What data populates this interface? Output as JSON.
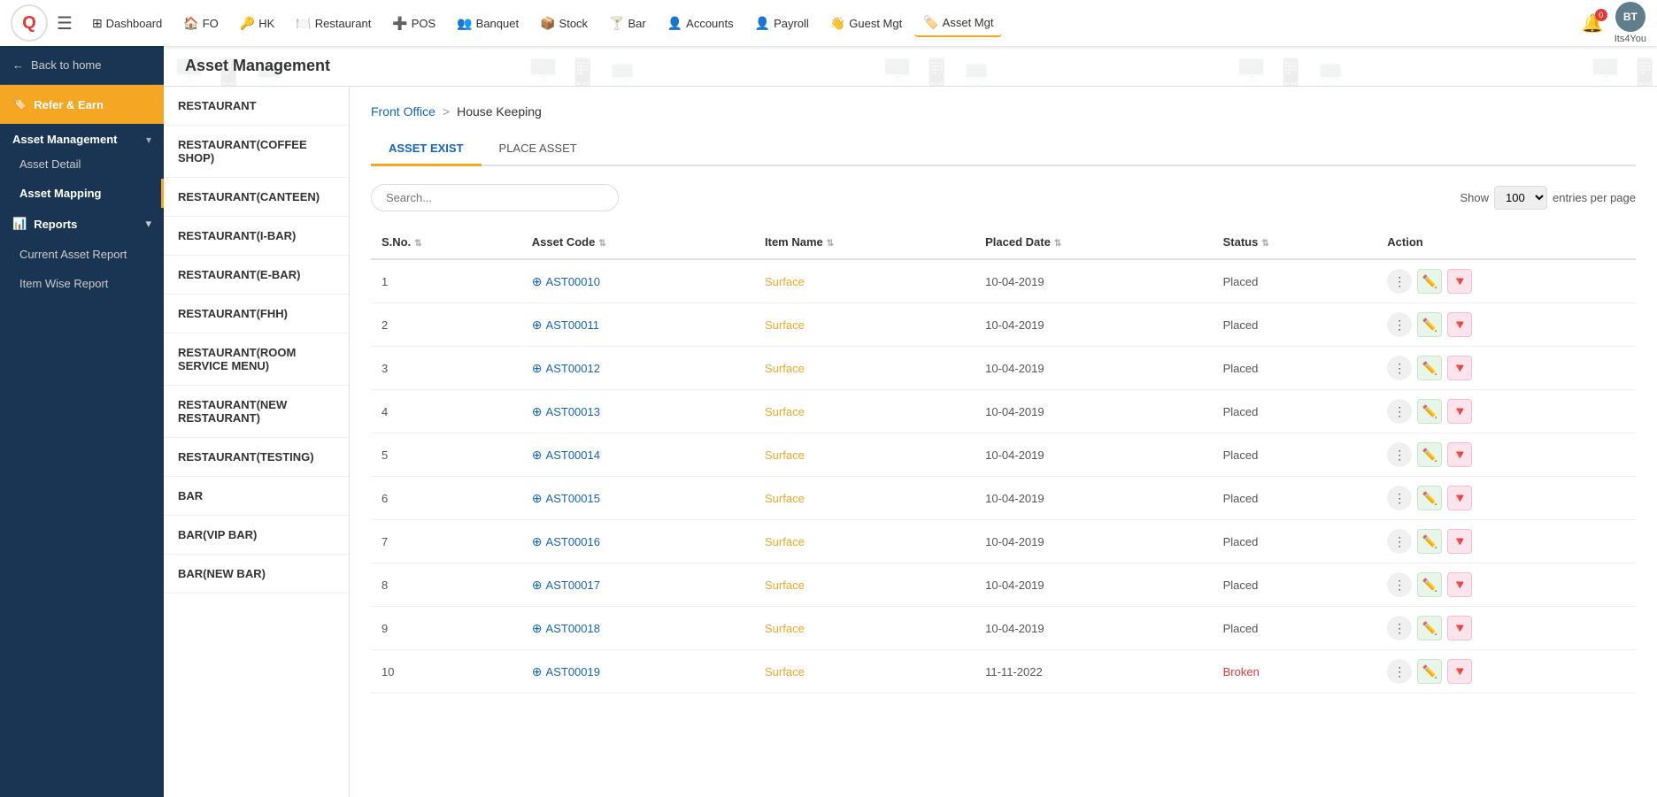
{
  "nav": {
    "hamburger": "☰",
    "logo_text": "Q",
    "items": [
      {
        "label": "Dashboard",
        "icon": "⊞",
        "active": false
      },
      {
        "label": "FO",
        "icon": "🏠",
        "active": false
      },
      {
        "label": "HK",
        "icon": "🔑",
        "active": false
      },
      {
        "label": "Restaurant",
        "icon": "🍽️",
        "active": false
      },
      {
        "label": "POS",
        "icon": "➕",
        "active": false
      },
      {
        "label": "Banquet",
        "icon": "👥",
        "active": false
      },
      {
        "label": "Stock",
        "icon": "📦",
        "active": false
      },
      {
        "label": "Bar",
        "icon": "🍸",
        "active": false
      },
      {
        "label": "Accounts",
        "icon": "👤",
        "active": false
      },
      {
        "label": "Payroll",
        "icon": "👤",
        "active": false
      },
      {
        "label": "Guest Mgt",
        "icon": "👋",
        "active": false
      },
      {
        "label": "Asset Mgt",
        "icon": "🏷️",
        "active": true
      }
    ],
    "bell_count": "0",
    "user_initials": "BT",
    "user_name": "Its4You"
  },
  "sidebar": {
    "back_label": "Back to home",
    "refer_label": "Refer & Earn",
    "asset_management_label": "Asset Management",
    "asset_detail_label": "Asset Detail",
    "asset_mapping_label": "Asset Mapping",
    "reports_label": "Reports",
    "current_asset_report_label": "Current Asset Report",
    "item_wise_report_label": "Item Wise Report"
  },
  "page_header": "Asset Management",
  "left_panel": {
    "items": [
      {
        "label": "RESTAURANT",
        "active": false
      },
      {
        "label": "RESTAURANT(COFFEE SHOP)",
        "active": false
      },
      {
        "label": "RESTAURANT(CANTEEN)",
        "active": false
      },
      {
        "label": "RESTAURANT(I-BAR)",
        "active": false
      },
      {
        "label": "RESTAURANT(E-BAR)",
        "active": false
      },
      {
        "label": "RESTAURANT(FHH)",
        "active": false
      },
      {
        "label": "RESTAURANT(ROOM SERVICE MENU)",
        "active": false
      },
      {
        "label": "RESTAURANT(NEW RESTAURANT)",
        "active": false
      },
      {
        "label": "RESTAURANT(TESTING)",
        "active": false
      },
      {
        "label": "BAR",
        "active": false
      },
      {
        "label": "BAR(VIP BAR)",
        "active": false
      },
      {
        "label": "BAR(NEW BAR)",
        "active": false
      }
    ]
  },
  "breadcrumb": {
    "home": "Front Office",
    "sep": ">",
    "current": "House Keeping"
  },
  "tabs": [
    {
      "label": "ASSET EXIST",
      "active": true
    },
    {
      "label": "PLACE ASSET",
      "active": false
    }
  ],
  "table_controls": {
    "search_placeholder": "Search...",
    "show_label": "Show",
    "entries_value": "100",
    "entries_label": "entries per page"
  },
  "table": {
    "columns": [
      "S.No.",
      "Asset Code",
      "Item Name",
      "Placed Date",
      "Status",
      "Action"
    ],
    "rows": [
      {
        "sno": "1",
        "asset_code": "AST00010",
        "item_name": "Surface",
        "placed_date": "10-04-2019",
        "status": "Placed",
        "status_type": "placed"
      },
      {
        "sno": "2",
        "asset_code": "AST00011",
        "item_name": "Surface",
        "placed_date": "10-04-2019",
        "status": "Placed",
        "status_type": "placed"
      },
      {
        "sno": "3",
        "asset_code": "AST00012",
        "item_name": "Surface",
        "placed_date": "10-04-2019",
        "status": "Placed",
        "status_type": "placed"
      },
      {
        "sno": "4",
        "asset_code": "AST00013",
        "item_name": "Surface",
        "placed_date": "10-04-2019",
        "status": "Placed",
        "status_type": "placed"
      },
      {
        "sno": "5",
        "asset_code": "AST00014",
        "item_name": "Surface",
        "placed_date": "10-04-2019",
        "status": "Placed",
        "status_type": "placed"
      },
      {
        "sno": "6",
        "asset_code": "AST00015",
        "item_name": "Surface",
        "placed_date": "10-04-2019",
        "status": "Placed",
        "status_type": "placed"
      },
      {
        "sno": "7",
        "asset_code": "AST00016",
        "item_name": "Surface",
        "placed_date": "10-04-2019",
        "status": "Placed",
        "status_type": "placed"
      },
      {
        "sno": "8",
        "asset_code": "AST00017",
        "item_name": "Surface",
        "placed_date": "10-04-2019",
        "status": "Placed",
        "status_type": "placed"
      },
      {
        "sno": "9",
        "asset_code": "AST00018",
        "item_name": "Surface",
        "placed_date": "10-04-2019",
        "status": "Placed",
        "status_type": "placed"
      },
      {
        "sno": "10",
        "asset_code": "AST00019",
        "item_name": "Surface",
        "placed_date": "11-11-2022",
        "status": "Broken",
        "status_type": "broken"
      }
    ]
  }
}
